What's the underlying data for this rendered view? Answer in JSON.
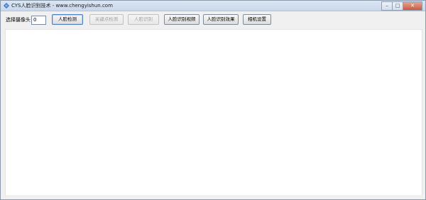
{
  "window": {
    "title": "CYS人脸识别技术 - www.chengyishun.com",
    "icon": "diamond-app-icon",
    "controls": {
      "minimize": "–",
      "maximize": "□",
      "close": "✕"
    }
  },
  "toolbar": {
    "camera_label": "选择摄像头",
    "camera_value": "0",
    "buttons": {
      "face_detect": "人脸检测",
      "keypoint_detect": "关键点检测",
      "face_recognize": "人脸识别",
      "face_recognize_video": "人脸识别视频",
      "face_recognize_effect": "人脸识别效果",
      "camera_settings": "相机设置"
    }
  },
  "colors": {
    "accent": "#2f6fc4",
    "disabled_text": "#a0a0a0"
  }
}
